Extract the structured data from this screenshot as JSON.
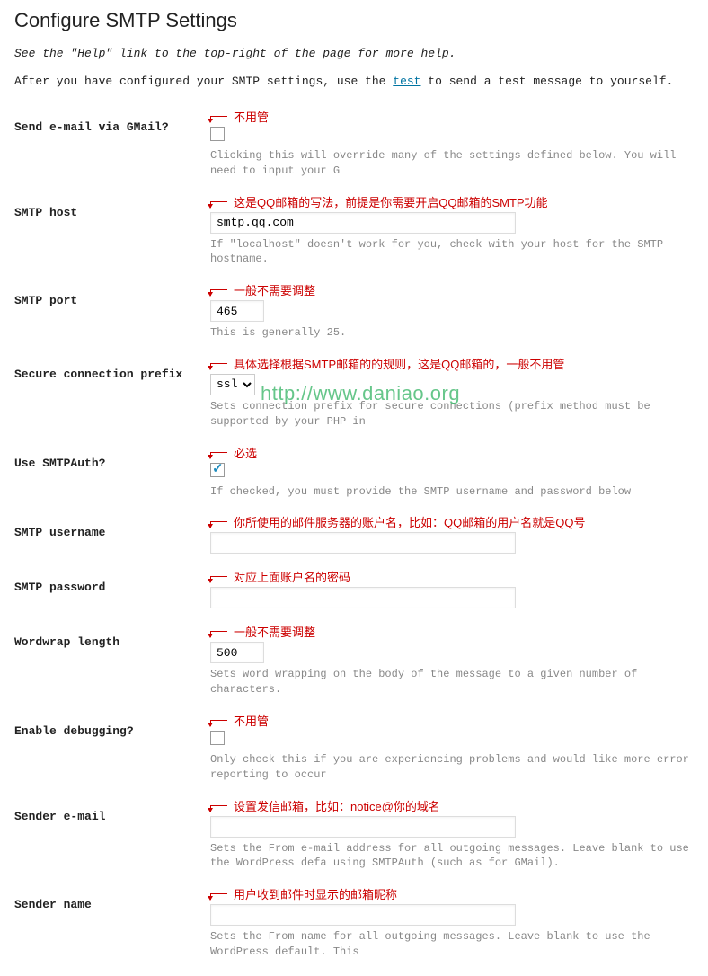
{
  "title": "Configure SMTP Settings",
  "help_line": "See the \"Help\" link to the top-right of the page for more help.",
  "intro_before": "After you have configured your SMTP settings, use the ",
  "intro_link": "test",
  "intro_after": " to send a test message to yourself.",
  "watermark": "http://www.daniao.org",
  "fields": {
    "gmail": {
      "label": "Send e-mail via GMail?",
      "annotation": "不用管",
      "checked": false,
      "hint": "Clicking this will override many of the settings defined below. You will need to input your G"
    },
    "host": {
      "label": "SMTP host",
      "annotation": "这是QQ邮箱的写法，前提是你需要开启QQ邮箱的SMTP功能",
      "value": "smtp.qq.com",
      "hint": "If \"localhost\" doesn't work for you, check with your host for the SMTP hostname."
    },
    "port": {
      "label": "SMTP port",
      "annotation": "一般不需要调整",
      "value": "465",
      "hint": "This is generally 25."
    },
    "secure": {
      "label": "Secure connection prefix",
      "annotation": "具体选择根据SMTP邮箱的的规则，这是QQ邮箱的，一般不用管",
      "value": "ssl",
      "hint": "Sets connection prefix for secure connections (prefix method must be supported by your PHP in"
    },
    "auth": {
      "label": "Use SMTPAuth?",
      "annotation": "必选",
      "checked": true,
      "hint": "If checked, you must provide the SMTP username and password below"
    },
    "username": {
      "label": "SMTP username",
      "annotation": "你所使用的邮件服务器的账户名，比如：QQ邮箱的用户名就是QQ号",
      "value": ""
    },
    "password": {
      "label": "SMTP password",
      "annotation": "对应上面账户名的密码",
      "value": ""
    },
    "wordwrap": {
      "label": "Wordwrap length",
      "annotation": "一般不需要调整",
      "value": "500",
      "hint": "Sets word wrapping on the body of the message to a given number of characters."
    },
    "debug": {
      "label": "Enable debugging?",
      "annotation": "不用管",
      "checked": false,
      "hint": "Only check this if you are experiencing problems and would like more error reporting to occur"
    },
    "sender_email": {
      "label": "Sender e-mail",
      "annotation": "设置发信邮箱，比如：notice@你的域名",
      "value": "",
      "hint": "Sets the From e-mail address for all outgoing messages. Leave blank to use the WordPress defa using SMTPAuth (such as for GMail)."
    },
    "sender_name": {
      "label": "Sender name",
      "annotation": "用户收到邮件时显示的邮箱昵称",
      "value": "",
      "hint": "Sets the From name for all outgoing messages. Leave blank to use the WordPress default. This"
    }
  }
}
